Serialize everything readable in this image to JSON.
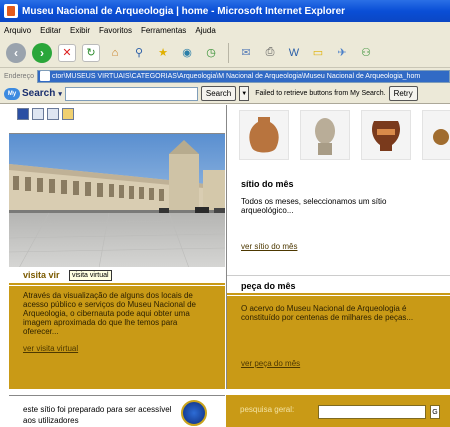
{
  "window": {
    "title": "Museu Nacional de Arqueologia | home - Microsoft Internet Explorer"
  },
  "menu": [
    "Arquivo",
    "Editar",
    "Exibir",
    "Favoritos",
    "Ferramentas",
    "Ajuda"
  ],
  "address": {
    "label": "Endereço",
    "value": "ctor\\MUSEUS VIRTUAIS\\CATEGORIAS\\Arqueologia\\M Nacional de Arqueologia\\Museu Nacional de Arqueologia_hom"
  },
  "mysearch": {
    "logo": "Search",
    "button": "Search",
    "message": "Failed to retrieve buttons from My Search.",
    "retry": "Retry"
  },
  "visita": {
    "title": "visita vir",
    "tooltip": "visita virtual",
    "text": "Através da visualização de alguns dos locais de acesso público e serviços do Museu Nacional de Arqueologia, o cibernauta pode aqui obter uma imagem aproximada do que lhe temos para oferecer...",
    "link": "ver visita virtual"
  },
  "sitio": {
    "title": "sítio do mês",
    "text": "Todos os meses, seleccionamos um sítio arqueológico...",
    "link": "ver sítio do mês"
  },
  "peca": {
    "title": "peça do mês",
    "text": "O acervo do Museu Nacional de Arqueologia é constituído por centenas de milhares de peças...",
    "link": "ver peça do mês"
  },
  "footer": {
    "text": "este sítio foi preparado para ser acessível aos utilizadores",
    "search_label": "pesquisa geral:",
    "go": "G"
  },
  "colors": {
    "accent": "#c99a16",
    "titlebar": "#0a4ed6"
  }
}
